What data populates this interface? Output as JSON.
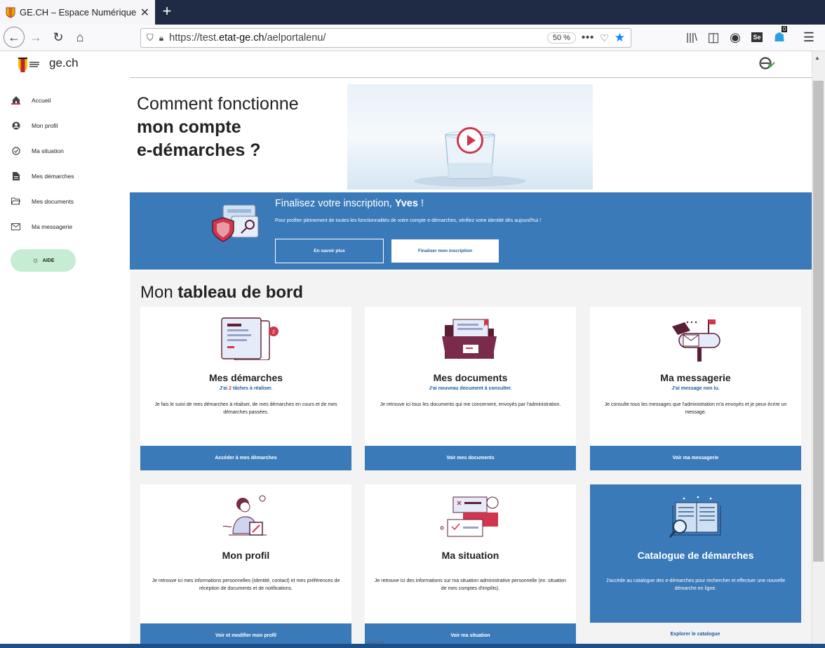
{
  "browser": {
    "tab_title": "GE.CH – Espace Numérique Us",
    "url_host": "https://test.",
    "url_domain": "etat-ge.ch",
    "url_path": "/aelportalenu/",
    "zoom": "50 %",
    "notif_count": "0"
  },
  "site": {
    "brand": "ge.ch"
  },
  "sidebar": {
    "items": [
      {
        "label": "Accueil",
        "icon": "home-icon"
      },
      {
        "label": "Mon profil",
        "icon": "user-icon"
      },
      {
        "label": "Ma situation",
        "icon": "check-circle-icon"
      },
      {
        "label": "Mes démarches",
        "icon": "file-icon"
      },
      {
        "label": "Mes documents",
        "icon": "folder-icon"
      },
      {
        "label": "Ma messagerie",
        "icon": "envelope-icon"
      }
    ],
    "help_label": "AIDE"
  },
  "hero": {
    "line1": "Comment fonctionne",
    "line2": "mon compte",
    "line3": "e-démarches ?"
  },
  "banner": {
    "title_prefix": "Finalisez votre inscription, ",
    "name": "Yves",
    "title_suffix": " !",
    "text": "Pour profiter pleinement de toutes les fonctionnalités de votre compte e-démarches, vérifiez votre identité dès aujourd'hui !",
    "btn_more": "En savoir plus",
    "btn_finalize": "Finaliser mon inscription"
  },
  "dashboard": {
    "title_prefix": "Mon ",
    "title_bold": "tableau de bord",
    "cards": [
      {
        "title": "Mes démarches",
        "sub_prefix": "J'ai ",
        "sub_count": "2",
        "sub_suffix": " tâches à réaliser.",
        "text": "Je fais le suivi de mes démarches à réaliser, de mes démarches en cours et de mes démarches passées.",
        "button": "Accéder à mes démarches",
        "badge": "2"
      },
      {
        "title": "Mes documents",
        "sub": "J'ai nouveau document à consulter.",
        "text": "Je retrouve ici tous les documents qui me concernent, envoyés par l'administration.",
        "button": "Voir mes documents"
      },
      {
        "title": "Ma messagerie",
        "sub": "J'ai message non lu.",
        "text": "Je consulte tous les messages que l'administration m'a envoyés et je peux écrire un message.",
        "button": "Voir ma messagerie"
      },
      {
        "title": "Mon profil",
        "text": "Je retrouve ici mes informations personnelles (identité, contact) et mes préférences de réception de documents et de notifications.",
        "button": "Voir et modifier mon profil"
      },
      {
        "title": "Ma situation",
        "text": "Je retrouve ici des informations sur ma situation administrative personnelle (ex: situation de mes comptes d'impôts).",
        "button": "Voir ma situation"
      },
      {
        "title": "Catalogue de démarches",
        "text": "J'accède au catalogue des e-démarches pour rechercher et effectuer une nouvelle démarche en ligne.",
        "button": "Explorer le catalogue"
      }
    ]
  },
  "footer_fragment": "mon.txt",
  "colors": {
    "primary_blue": "#3b7ab9",
    "accent_red": "#d0364c",
    "dark_plum": "#5a1f35",
    "help_green": "#c6ecd3"
  }
}
